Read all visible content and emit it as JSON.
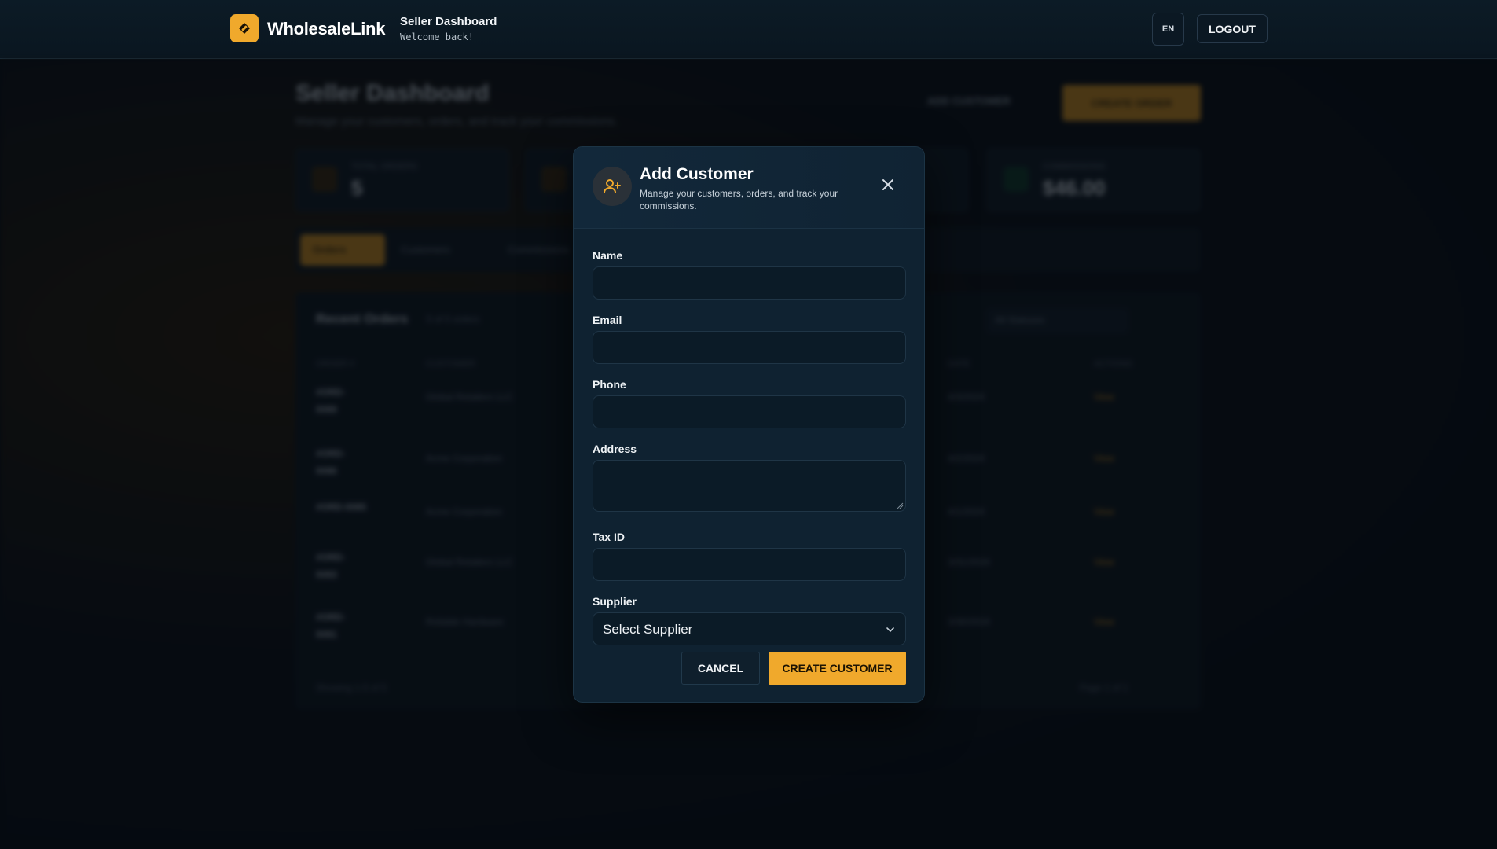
{
  "colors": {
    "accent": "#f0a92c",
    "background": "#070d13",
    "modal": "#0f2231"
  },
  "app": {
    "brand": "WholesaleLink",
    "page_title": "Seller Dashboard",
    "welcome": "Welcome back!",
    "lang": "EN",
    "logout": "LOGOUT"
  },
  "background": {
    "title": "Seller Dashboard",
    "subtitle": "Manage your customers, orders, and track your commissions.",
    "add_customer": "ADD CUSTOMER",
    "create_order": "CREATE ORDER",
    "stats": [
      {
        "label": "TOTAL ORDERS",
        "value": "5"
      },
      {
        "label": "",
        "value": ""
      },
      {
        "label": "",
        "value": ""
      },
      {
        "label": "COMMISSIONS",
        "value": "$46.00"
      }
    ],
    "tabs": [
      "Orders",
      "Customers",
      "Commissions"
    ],
    "panel_title": "Recent Orders",
    "panel_count": "5 of 5 orders",
    "filter": "All Statuses",
    "columns": [
      "ORDER #",
      "CUSTOMER",
      "DATE",
      "ACTIONS"
    ],
    "rows": [
      {
        "id": "#ORD-\n0089",
        "customer": "Global Retailers LLC",
        "date": "4/3/2024",
        "action": "View"
      },
      {
        "id": "#ORD-\n0086",
        "customer": "Acme Corporation",
        "date": "4/2/2024",
        "action": "View"
      },
      {
        "id": "#ORD-0085",
        "customer": "Acme Corporation",
        "date": "4/1/2024",
        "action": "View"
      },
      {
        "id": "#ORD-\n0083",
        "customer": "Global Retailers LLC",
        "date": "3/31/2024",
        "action": "View"
      },
      {
        "id": "#ORD-\n0081",
        "customer": "Reliable Hardware",
        "date": "3/30/2024",
        "action": "View"
      }
    ],
    "footer": "Showing 1-5 of 5",
    "page": "Page 1 of 1"
  },
  "modal": {
    "title": "Add Customer",
    "subtitle": "Manage your customers, orders, and track your commissions.",
    "fields": {
      "name_label": "Name",
      "email_label": "Email",
      "phone_label": "Phone",
      "address_label": "Address",
      "tax_label": "Tax ID",
      "supplier_label": "Supplier",
      "supplier_value": "Select Supplier"
    },
    "cancel": "CANCEL",
    "create": "CREATE CUSTOMER"
  }
}
